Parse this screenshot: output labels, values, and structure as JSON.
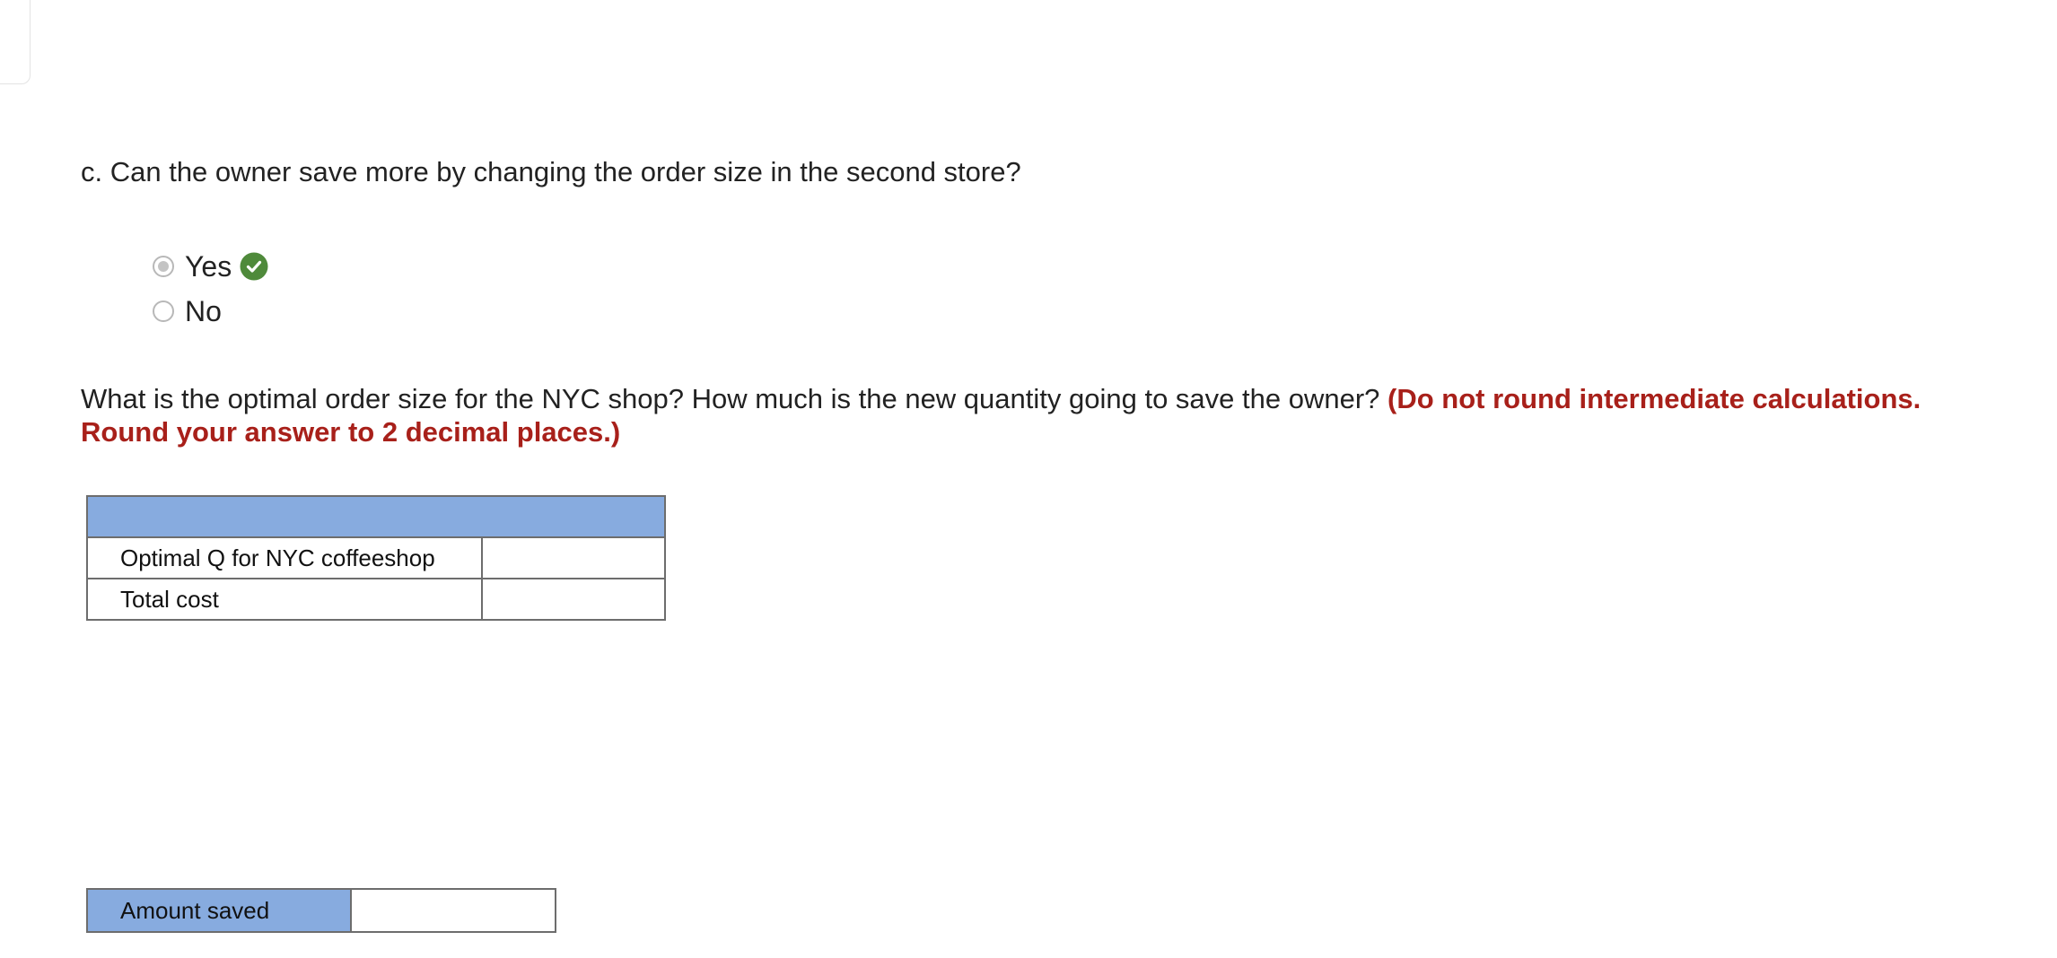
{
  "question_c": {
    "text": "c. Can the owner save more by changing the order size in the second store?",
    "options": [
      {
        "label": "Yes",
        "selected": true,
        "correct": true
      },
      {
        "label": "No",
        "selected": false
      }
    ],
    "correct_icon": "check-circle-icon",
    "correct_color": "#4f8a3b"
  },
  "question_optimal": {
    "text": "What is the optimal order size for the NYC shop? How much is the new quantity going to save the owner?",
    "hint": "(Do not round intermediate calculations. Round your answer to 2 decimal places.)",
    "hint_color": "#a8201a"
  },
  "optimal_table": {
    "header_color": "#87abdf",
    "rows": [
      {
        "label": "Optimal Q for NYC coffeeshop",
        "value": ""
      },
      {
        "label": "Total cost",
        "value": ""
      }
    ]
  },
  "saved_table": {
    "label": "Amount saved",
    "value": ""
  }
}
